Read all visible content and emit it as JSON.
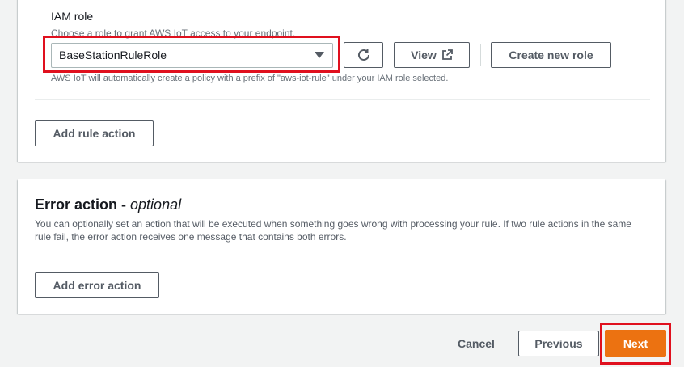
{
  "iam": {
    "title": "IAM role",
    "description": "Choose a role to grant AWS IoT access to your endpoint.",
    "selected_role": "BaseStationRuleRole",
    "view_label": "View",
    "create_label": "Create new role",
    "note": "AWS IoT will automatically create a policy with a prefix of \"aws-iot-rule\" under your IAM role selected."
  },
  "rule": {
    "add_label": "Add rule action"
  },
  "error_action": {
    "title": "Error action - ",
    "title_optional": "optional",
    "description": "You can optionally set an action that will be executed when something goes wrong with processing your rule. If two rule actions in the same rule fail, the error action receives one message that contains both errors.",
    "add_label": "Add error action"
  },
  "footer": {
    "cancel_label": "Cancel",
    "previous_label": "Previous",
    "next_label": "Next"
  },
  "colors": {
    "primary": "#ec7211",
    "highlight": "#e0101e",
    "border": "#545b64"
  }
}
